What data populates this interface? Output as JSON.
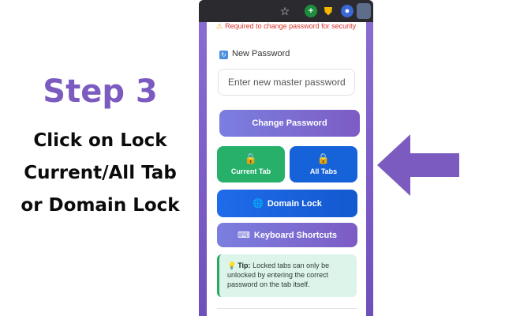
{
  "caption": {
    "step": "Step 3",
    "lines": [
      "Click on Lock",
      "Current/All Tab",
      "or Domain Lock"
    ]
  },
  "browser": {
    "icons": [
      "star-icon",
      "extension-green-icon",
      "shield-extension-icon",
      "extension-round-icon",
      "active-extension-icon"
    ]
  },
  "popup": {
    "warning": "Required to change password for security",
    "new_password_label": "New Password",
    "password_placeholder": "Enter new master password",
    "change_password_label": "Change Password",
    "current_tab_label": "Current Tab",
    "all_tabs_label": "All Tabs",
    "domain_lock_label": "Domain Lock",
    "keyboard_shortcuts_label": "Keyboard Shortcuts",
    "tip_title": "Tip:",
    "tip_text": "Locked tabs can only be unlocked by entering the correct password on the tab itself."
  },
  "colors": {
    "accent_purple": "#7b5bbf",
    "green_button": "#26b06a",
    "blue_button": "#1662d8",
    "warning_red": "#d9342b"
  }
}
